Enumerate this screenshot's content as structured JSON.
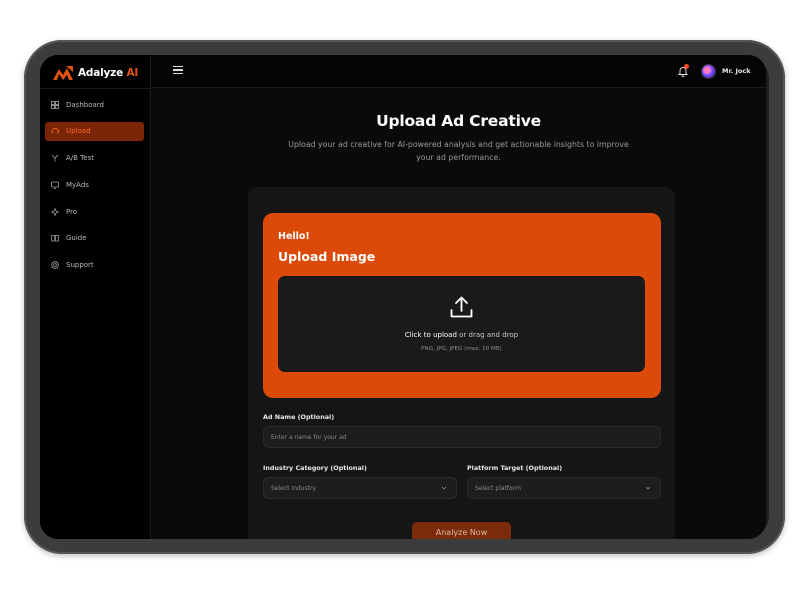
{
  "brand": {
    "name": "Adalyze",
    "suffix": "AI",
    "accent": "#e05212"
  },
  "sidebar": {
    "items": [
      {
        "label": "Dashboard",
        "icon": "grid-icon",
        "active": false
      },
      {
        "label": "Upload",
        "icon": "upload-cloud-icon",
        "active": true
      },
      {
        "label": "A/B Test",
        "icon": "split-icon",
        "active": false
      },
      {
        "label": "MyAds",
        "icon": "ads-icon",
        "active": false
      },
      {
        "label": "Pro",
        "icon": "sparkle-icon",
        "active": false
      },
      {
        "label": "Guide",
        "icon": "book-icon",
        "active": false
      },
      {
        "label": "Support",
        "icon": "lifebuoy-icon",
        "active": false
      }
    ]
  },
  "topbar": {
    "username": "Mr. Jock"
  },
  "main": {
    "title": "Upload Ad Creative",
    "subtitle": "Upload your ad creative for AI-powered analysis and get actionable insights to improve your ad performance."
  },
  "upload": {
    "greeting": "Hello!",
    "title": "Upload Image",
    "click_text": "Click to upload",
    "drag_text": " or drag and drop",
    "hint": "PNG, JPG, JPEG (max. 10 MB)"
  },
  "form": {
    "ad_name_label": "Ad Name (Optional)",
    "ad_name_placeholder": "Enter a name for your ad",
    "industry_label": "Industry Category (Optional)",
    "industry_value": "Select industry",
    "platform_label": "Platform Target (Optional)",
    "platform_value": "Select platform",
    "submit_label": "Analyze Now"
  }
}
